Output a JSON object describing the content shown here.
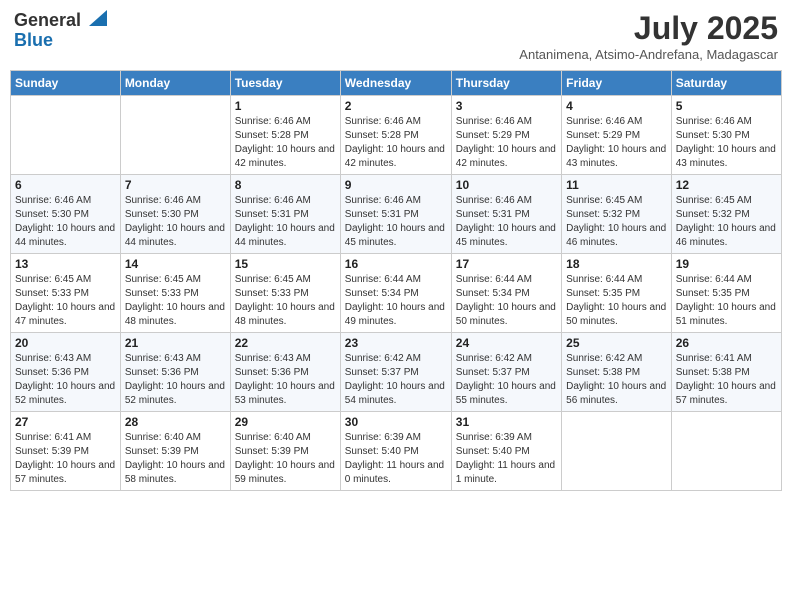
{
  "header": {
    "logo_general": "General",
    "logo_blue": "Blue",
    "month_year": "July 2025",
    "location": "Antanimena, Atsimo-Andrefana, Madagascar"
  },
  "days_of_week": [
    "Sunday",
    "Monday",
    "Tuesday",
    "Wednesday",
    "Thursday",
    "Friday",
    "Saturday"
  ],
  "weeks": [
    [
      {
        "day": "",
        "sunrise": "",
        "sunset": "",
        "daylight": ""
      },
      {
        "day": "",
        "sunrise": "",
        "sunset": "",
        "daylight": ""
      },
      {
        "day": "1",
        "sunrise": "Sunrise: 6:46 AM",
        "sunset": "Sunset: 5:28 PM",
        "daylight": "Daylight: 10 hours and 42 minutes."
      },
      {
        "day": "2",
        "sunrise": "Sunrise: 6:46 AM",
        "sunset": "Sunset: 5:28 PM",
        "daylight": "Daylight: 10 hours and 42 minutes."
      },
      {
        "day": "3",
        "sunrise": "Sunrise: 6:46 AM",
        "sunset": "Sunset: 5:29 PM",
        "daylight": "Daylight: 10 hours and 42 minutes."
      },
      {
        "day": "4",
        "sunrise": "Sunrise: 6:46 AM",
        "sunset": "Sunset: 5:29 PM",
        "daylight": "Daylight: 10 hours and 43 minutes."
      },
      {
        "day": "5",
        "sunrise": "Sunrise: 6:46 AM",
        "sunset": "Sunset: 5:30 PM",
        "daylight": "Daylight: 10 hours and 43 minutes."
      }
    ],
    [
      {
        "day": "6",
        "sunrise": "Sunrise: 6:46 AM",
        "sunset": "Sunset: 5:30 PM",
        "daylight": "Daylight: 10 hours and 44 minutes."
      },
      {
        "day": "7",
        "sunrise": "Sunrise: 6:46 AM",
        "sunset": "Sunset: 5:30 PM",
        "daylight": "Daylight: 10 hours and 44 minutes."
      },
      {
        "day": "8",
        "sunrise": "Sunrise: 6:46 AM",
        "sunset": "Sunset: 5:31 PM",
        "daylight": "Daylight: 10 hours and 44 minutes."
      },
      {
        "day": "9",
        "sunrise": "Sunrise: 6:46 AM",
        "sunset": "Sunset: 5:31 PM",
        "daylight": "Daylight: 10 hours and 45 minutes."
      },
      {
        "day": "10",
        "sunrise": "Sunrise: 6:46 AM",
        "sunset": "Sunset: 5:31 PM",
        "daylight": "Daylight: 10 hours and 45 minutes."
      },
      {
        "day": "11",
        "sunrise": "Sunrise: 6:45 AM",
        "sunset": "Sunset: 5:32 PM",
        "daylight": "Daylight: 10 hours and 46 minutes."
      },
      {
        "day": "12",
        "sunrise": "Sunrise: 6:45 AM",
        "sunset": "Sunset: 5:32 PM",
        "daylight": "Daylight: 10 hours and 46 minutes."
      }
    ],
    [
      {
        "day": "13",
        "sunrise": "Sunrise: 6:45 AM",
        "sunset": "Sunset: 5:33 PM",
        "daylight": "Daylight: 10 hours and 47 minutes."
      },
      {
        "day": "14",
        "sunrise": "Sunrise: 6:45 AM",
        "sunset": "Sunset: 5:33 PM",
        "daylight": "Daylight: 10 hours and 48 minutes."
      },
      {
        "day": "15",
        "sunrise": "Sunrise: 6:45 AM",
        "sunset": "Sunset: 5:33 PM",
        "daylight": "Daylight: 10 hours and 48 minutes."
      },
      {
        "day": "16",
        "sunrise": "Sunrise: 6:44 AM",
        "sunset": "Sunset: 5:34 PM",
        "daylight": "Daylight: 10 hours and 49 minutes."
      },
      {
        "day": "17",
        "sunrise": "Sunrise: 6:44 AM",
        "sunset": "Sunset: 5:34 PM",
        "daylight": "Daylight: 10 hours and 50 minutes."
      },
      {
        "day": "18",
        "sunrise": "Sunrise: 6:44 AM",
        "sunset": "Sunset: 5:35 PM",
        "daylight": "Daylight: 10 hours and 50 minutes."
      },
      {
        "day": "19",
        "sunrise": "Sunrise: 6:44 AM",
        "sunset": "Sunset: 5:35 PM",
        "daylight": "Daylight: 10 hours and 51 minutes."
      }
    ],
    [
      {
        "day": "20",
        "sunrise": "Sunrise: 6:43 AM",
        "sunset": "Sunset: 5:36 PM",
        "daylight": "Daylight: 10 hours and 52 minutes."
      },
      {
        "day": "21",
        "sunrise": "Sunrise: 6:43 AM",
        "sunset": "Sunset: 5:36 PM",
        "daylight": "Daylight: 10 hours and 52 minutes."
      },
      {
        "day": "22",
        "sunrise": "Sunrise: 6:43 AM",
        "sunset": "Sunset: 5:36 PM",
        "daylight": "Daylight: 10 hours and 53 minutes."
      },
      {
        "day": "23",
        "sunrise": "Sunrise: 6:42 AM",
        "sunset": "Sunset: 5:37 PM",
        "daylight": "Daylight: 10 hours and 54 minutes."
      },
      {
        "day": "24",
        "sunrise": "Sunrise: 6:42 AM",
        "sunset": "Sunset: 5:37 PM",
        "daylight": "Daylight: 10 hours and 55 minutes."
      },
      {
        "day": "25",
        "sunrise": "Sunrise: 6:42 AM",
        "sunset": "Sunset: 5:38 PM",
        "daylight": "Daylight: 10 hours and 56 minutes."
      },
      {
        "day": "26",
        "sunrise": "Sunrise: 6:41 AM",
        "sunset": "Sunset: 5:38 PM",
        "daylight": "Daylight: 10 hours and 57 minutes."
      }
    ],
    [
      {
        "day": "27",
        "sunrise": "Sunrise: 6:41 AM",
        "sunset": "Sunset: 5:39 PM",
        "daylight": "Daylight: 10 hours and 57 minutes."
      },
      {
        "day": "28",
        "sunrise": "Sunrise: 6:40 AM",
        "sunset": "Sunset: 5:39 PM",
        "daylight": "Daylight: 10 hours and 58 minutes."
      },
      {
        "day": "29",
        "sunrise": "Sunrise: 6:40 AM",
        "sunset": "Sunset: 5:39 PM",
        "daylight": "Daylight: 10 hours and 59 minutes."
      },
      {
        "day": "30",
        "sunrise": "Sunrise: 6:39 AM",
        "sunset": "Sunset: 5:40 PM",
        "daylight": "Daylight: 11 hours and 0 minutes."
      },
      {
        "day": "31",
        "sunrise": "Sunrise: 6:39 AM",
        "sunset": "Sunset: 5:40 PM",
        "daylight": "Daylight: 11 hours and 1 minute."
      },
      {
        "day": "",
        "sunrise": "",
        "sunset": "",
        "daylight": ""
      },
      {
        "day": "",
        "sunrise": "",
        "sunset": "",
        "daylight": ""
      }
    ]
  ]
}
